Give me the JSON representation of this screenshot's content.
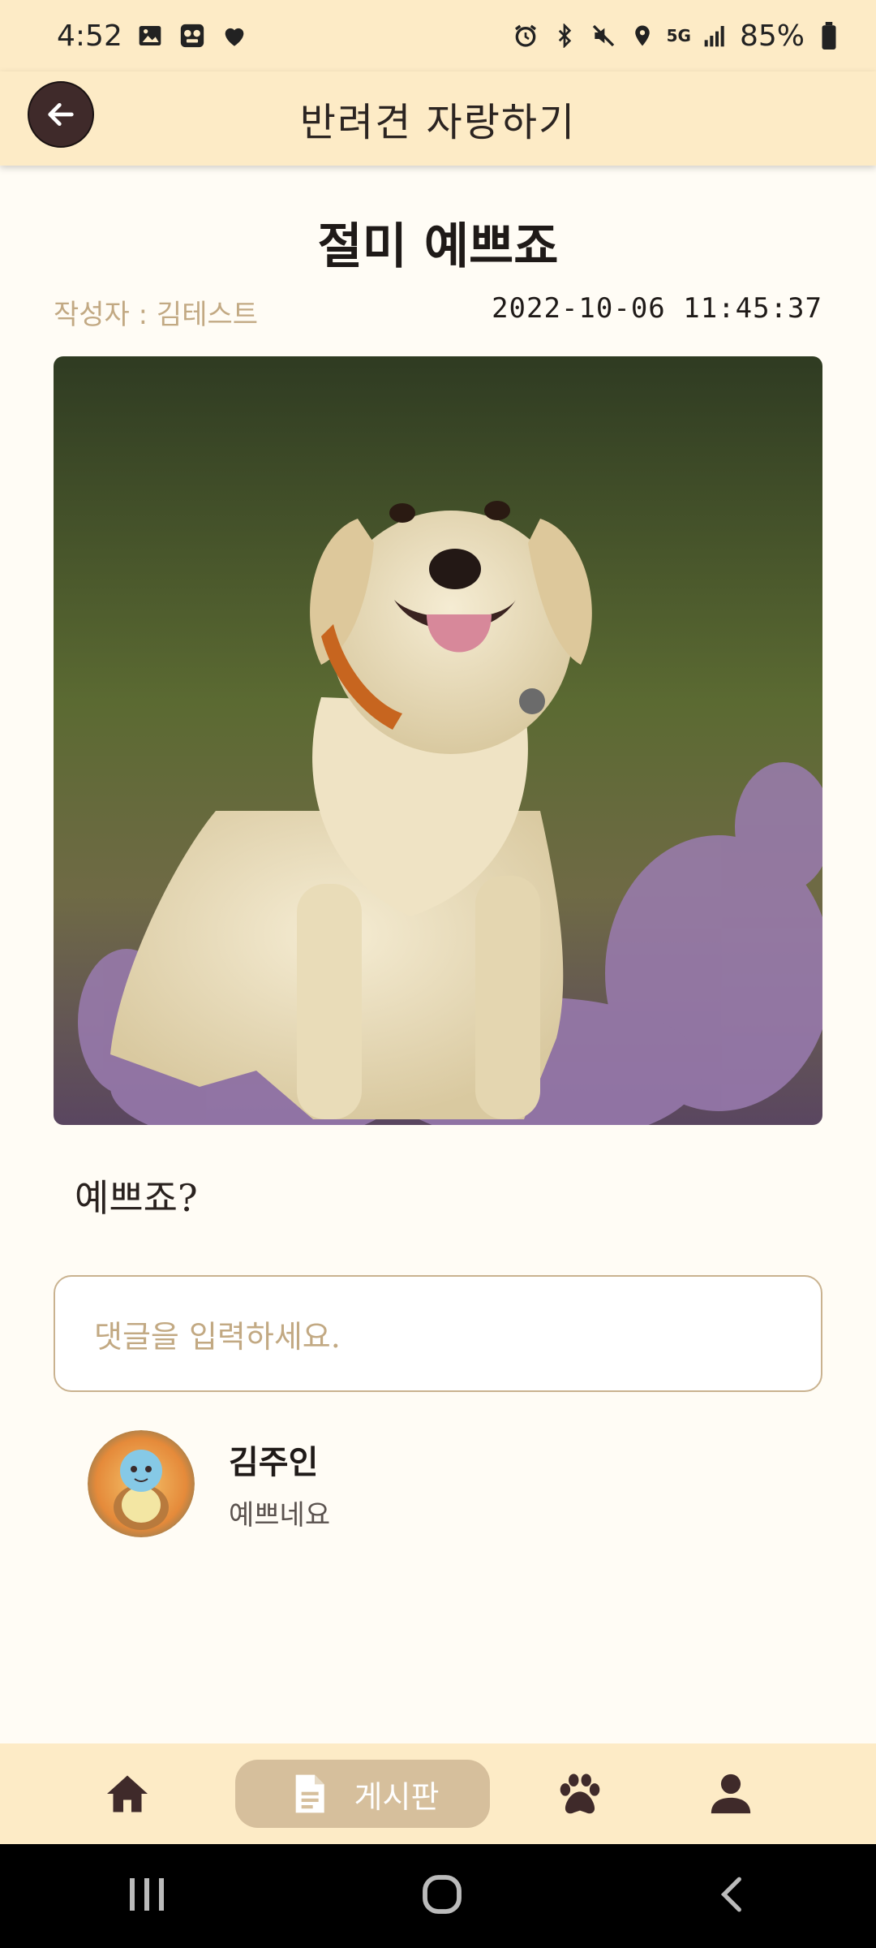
{
  "status_bar": {
    "time": "4:52",
    "battery": "85%",
    "network": "5G"
  },
  "app_bar": {
    "title": "반려견 자랑하기"
  },
  "post": {
    "title": "절미 예쁘죠",
    "author": "작성자 : 김테스트",
    "datetime": "2022-10-06 11:45:37",
    "body": "예쁘죠?"
  },
  "comment_input": {
    "placeholder": "댓글을 입력하세요."
  },
  "comments": [
    {
      "name": "김주인",
      "text": "예쁘네요"
    }
  ],
  "bottom_nav": {
    "active_label": "게시판"
  },
  "colors": {
    "header_bg": "#fdebc6",
    "page_bg": "#fffcf5",
    "accent_tan": "#d6bf9c",
    "muted_text": "#c2a983",
    "dark_brown": "#3f2a2a"
  }
}
